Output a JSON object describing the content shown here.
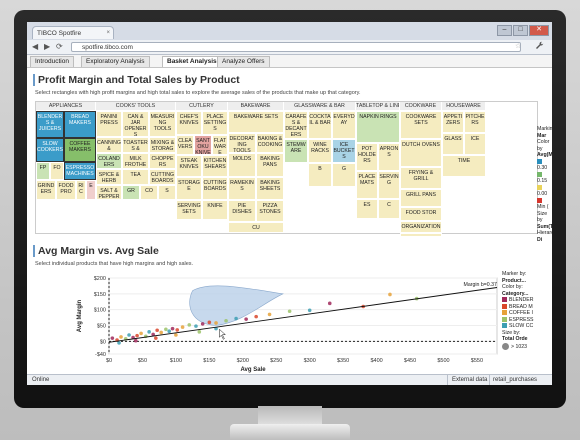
{
  "browser": {
    "tab_title": "TIBCO Spotfire",
    "url": "spotfire.tibco.com",
    "close_glyph": "×",
    "minimize_glyph": "–",
    "maximize_glyph": "□",
    "window_close_glyph": "✕",
    "back_glyph": "◀",
    "forward_glyph": "▶",
    "reload_glyph": "⟳",
    "star_glyph": "☆",
    "wrench_glyph": "🔧",
    "star_icon": "star-icon",
    "wrench_icon": "wrench-icon"
  },
  "app_tabs": [
    {
      "label": "Introduction",
      "active": false
    },
    {
      "label": "Exploratory Analysis",
      "active": false
    },
    {
      "label": "Basket Analysis",
      "active": true
    },
    {
      "label": "Analyze Offers",
      "active": false
    }
  ],
  "treemap_panel": {
    "title": "Profit Margin and Total Sales by Product",
    "subtitle": "Select rectangles with high profit margins and high total sales to explore the average sales of the products that make up that category."
  },
  "treemap": {
    "categories": [
      {
        "name": "APPLIANCES",
        "cells": [
          "BLENDERS & JUICERS",
          "BREAD MAKERS",
          "SLOW COOKERS",
          "COFFEE MAKERS",
          "ESPRESSO MACHINES",
          "FP",
          "FO",
          "GRINDERS",
          "FOOD PRO",
          "RIC",
          "E"
        ]
      },
      {
        "name": "COOKS' TOOLS",
        "cells": [
          "PANINI PRESS",
          "CAN & JAR OPENERS",
          "MEASURING TOOLS",
          "CANNING & PRESERVING",
          "TOASTERS & OVENS",
          "MIXING & STORAGE",
          "COLANDERS",
          "MILK FROTHERS",
          "CHOPPERS",
          "SPICE & HERB",
          "TEA",
          "CUTTING BOARDS",
          "SALT & PEPPER",
          "GR",
          "CO",
          "S"
        ]
      },
      {
        "name": "CUTLERY",
        "cells": [
          "CHEF'S KNIVES",
          "PLACE SETTINGS",
          "CLEAVERS",
          "SANTOKU KNIVES",
          "FLATWARE",
          "STEAK KNIVES",
          "KITCHEN SHEARS",
          "STORAGE",
          "CUTTING BOARDS",
          "SERVING SETS",
          "KNIFE"
        ]
      },
      {
        "name": "BAKEWARE",
        "cells": [
          "BAKEWARE SETS",
          "DECORATING TOOLS",
          "BAKING & COOKING",
          "MOLDS",
          "BAKING PANS",
          "RAMEKINS",
          "BAKING SHEETS",
          "PIE DISHES",
          "PIZZA STONES",
          "CU"
        ]
      },
      {
        "name": "GLASSWARE & BAR",
        "cells": [
          "CARAFES & DECANTERS",
          "COCKTAIL & BAR",
          "EVERYDAY",
          "STEMWARE",
          "WINE RACKS",
          "ICE BUCKETS",
          "B",
          "G"
        ]
      },
      {
        "name": "TABLETOP & LINENS",
        "cells": [
          "NAPKIN RINGS",
          "POT HOLDERS",
          "PLACE MATS",
          "APRONS",
          "SERVING",
          "ES",
          "C"
        ]
      },
      {
        "name": "COOKWARE",
        "cells": [
          "COOKWARE SETS",
          "DUTCH OVENS",
          "FRYING & GRILL",
          "GRILL PANS",
          "FOOD STOR",
          "ORGANIZATION",
          "TUBE"
        ]
      },
      {
        "name": "HOUSEWARE",
        "cells": [
          "APPETIZERS",
          "PITCHERS",
          "GLASS",
          "ICE",
          "TIME"
        ]
      }
    ]
  },
  "treemap_legend": {
    "marking_label": "Marking",
    "marking_value": "Mar",
    "color_label": "Color by",
    "color_value": "Avg(M",
    "color_stops": [
      "0.30",
      "0.15",
      "0.00",
      "Min ("
    ],
    "size_label": "Size by",
    "size_value": "Sum(T",
    "hierarchy_label": "Hierarc",
    "hierarchy_value": "Di"
  },
  "scatter_panel": {
    "title": "Avg Margin vs. Avg Sale",
    "subtitle": "Select individual products that have high margins and high sales."
  },
  "chart_data": {
    "type": "scatter",
    "xlabel": "Avg Sale",
    "ylabel": "Avg Margin",
    "xlim": [
      0,
      580
    ],
    "ylim": [
      -40,
      200
    ],
    "x_ticks": [
      "$0",
      "$50",
      "$100",
      "$150",
      "$200",
      "$250",
      "$300",
      "$350",
      "$400",
      "$450",
      "$500",
      "$550"
    ],
    "y_ticks": [
      "$200",
      "$150",
      "$100",
      "$50",
      "$0",
      "-$40"
    ],
    "regression_label": "Margin\nb=0.37",
    "legend": {
      "marker_label": "Marker by:",
      "marker_value": "Product...",
      "color_label": "Color by:",
      "color_value": "Category...",
      "series": [
        {
          "name": "BLENDER",
          "color": "#a0285a"
        },
        {
          "name": "BREAD M",
          "color": "#d9472b"
        },
        {
          "name": "COFFEE I",
          "color": "#e6a23a"
        },
        {
          "name": "ESPRESS",
          "color": "#9cc36a"
        },
        {
          "name": "SLOW CC",
          "color": "#3d9fb3"
        }
      ],
      "size_label": "Size by:",
      "size_value": "Total Orde",
      "size_sample": "> 1023"
    },
    "points": [
      {
        "x": 5,
        "y": 10
      },
      {
        "x": 12,
        "y": 4
      },
      {
        "x": 18,
        "y": 14
      },
      {
        "x": 25,
        "y": 8
      },
      {
        "x": 30,
        "y": 20
      },
      {
        "x": 36,
        "y": 12
      },
      {
        "x": 42,
        "y": 18
      },
      {
        "x": 48,
        "y": 25
      },
      {
        "x": 55,
        "y": 16
      },
      {
        "x": 60,
        "y": 30
      },
      {
        "x": 66,
        "y": 22
      },
      {
        "x": 72,
        "y": 35
      },
      {
        "x": 78,
        "y": 28
      },
      {
        "x": 85,
        "y": 38
      },
      {
        "x": 90,
        "y": 32
      },
      {
        "x": 95,
        "y": 40
      },
      {
        "x": 102,
        "y": 36
      },
      {
        "x": 110,
        "y": 45
      },
      {
        "x": 120,
        "y": 52
      },
      {
        "x": 130,
        "y": 48
      },
      {
        "x": 140,
        "y": 55
      },
      {
        "x": 150,
        "y": 60
      },
      {
        "x": 160,
        "y": 58
      },
      {
        "x": 175,
        "y": 65
      },
      {
        "x": 190,
        "y": 72
      },
      {
        "x": 205,
        "y": 70
      },
      {
        "x": 220,
        "y": 78
      },
      {
        "x": 240,
        "y": 85
      },
      {
        "x": 270,
        "y": 95
      },
      {
        "x": 300,
        "y": 98
      },
      {
        "x": 330,
        "y": 120
      },
      {
        "x": 380,
        "y": 110
      },
      {
        "x": 420,
        "y": 148
      },
      {
        "x": 460,
        "y": 135
      },
      {
        "x": 15,
        "y": -5
      },
      {
        "x": 40,
        "y": 2
      },
      {
        "x": 70,
        "y": 10
      },
      {
        "x": 100,
        "y": 20
      },
      {
        "x": 135,
        "y": 30
      },
      {
        "x": 160,
        "y": 40
      }
    ],
    "colors": [
      "#a0285a",
      "#d9472b",
      "#e6a23a",
      "#9cc36a",
      "#3d9fb3"
    ]
  },
  "status_bar": {
    "left": "Online",
    "mid": "External data",
    "right": "retail_purchases"
  }
}
